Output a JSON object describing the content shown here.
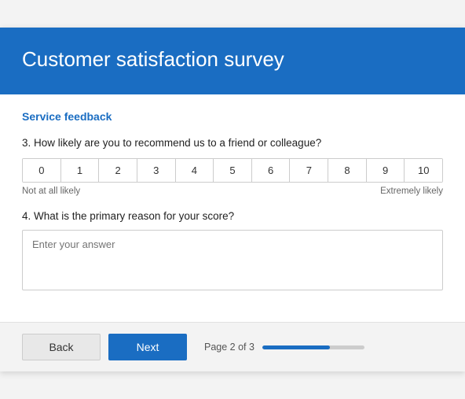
{
  "header": {
    "title": "Customer satisfaction survey"
  },
  "section": {
    "label": "Service feedback"
  },
  "question3": {
    "number": "3.",
    "text": "How likely are you to recommend us to a friend or colleague?",
    "scale": [
      0,
      1,
      2,
      3,
      4,
      5,
      6,
      7,
      8,
      9,
      10
    ],
    "label_low": "Not at all likely",
    "label_high": "Extremely likely"
  },
  "question4": {
    "number": "4.",
    "text": "What is the primary reason for your score?",
    "placeholder": "Enter your answer"
  },
  "footer": {
    "back_label": "Back",
    "next_label": "Next",
    "page_text": "Page 2 of 3",
    "progress_percent": 66
  }
}
